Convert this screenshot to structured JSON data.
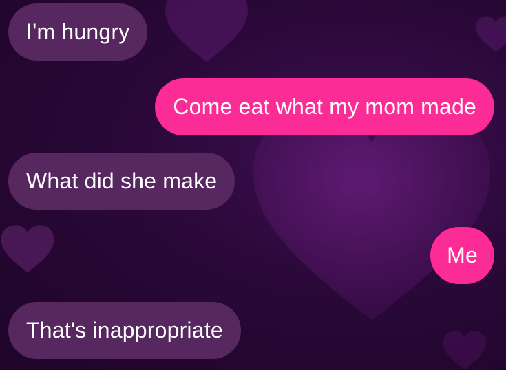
{
  "colors": {
    "background": "#2a0838",
    "received_bubble": "#57285f",
    "sent_bubble": "#fb2c95",
    "text": "#ffffff"
  },
  "messages": [
    {
      "direction": "received",
      "text": "I'm hungry"
    },
    {
      "direction": "sent",
      "text": "Come eat what my mom made"
    },
    {
      "direction": "received",
      "text": "What did she make"
    },
    {
      "direction": "sent",
      "text": "Me"
    },
    {
      "direction": "received",
      "text": "That's inappropriate"
    }
  ],
  "background_decorations": [
    "heart-icon",
    "heart-icon",
    "heart-icon",
    "heart-icon",
    "heart-icon"
  ]
}
